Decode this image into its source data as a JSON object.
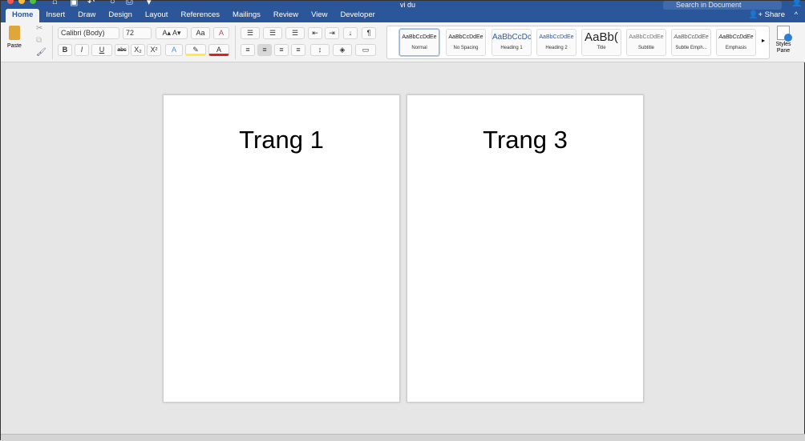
{
  "window": {
    "title": "vi du",
    "search_placeholder": "Search in Document"
  },
  "tabs": [
    "Home",
    "Insert",
    "Draw",
    "Design",
    "Layout",
    "References",
    "Mailings",
    "Review",
    "View",
    "Developer"
  ],
  "active_tab": "Home",
  "share_label": "Share",
  "ribbon": {
    "paste_label": "Paste",
    "font_name": "Calibri (Body)",
    "font_size": "72",
    "bold": "B",
    "italic": "I",
    "underline": "U",
    "strikethrough": "abc",
    "subscript": "X₂",
    "superscript": "X²",
    "styles": [
      {
        "preview": "AaBbCcDdEe",
        "name": "Normal"
      },
      {
        "preview": "AaBbCcDdEe",
        "name": "No Spacing"
      },
      {
        "preview": "AaBbCcDc",
        "name": "Heading 1"
      },
      {
        "preview": "AaBbCcDdEe",
        "name": "Heading 2"
      },
      {
        "preview": "AaBb(",
        "name": "Title"
      },
      {
        "preview": "AaBbCcDdEe",
        "name": "Subtitle"
      },
      {
        "preview": "AaBbCcDdEe",
        "name": "Subtle Emph..."
      },
      {
        "preview": "AaBbCcDdEe",
        "name": "Emphasis"
      }
    ],
    "styles_pane_label": "Styles Pane"
  },
  "pages": [
    "Trang 1",
    "Trang 3"
  ],
  "colors": {
    "brand": "#2b579a",
    "highlight": "#ffeb3b",
    "font_color": "#e02020"
  }
}
